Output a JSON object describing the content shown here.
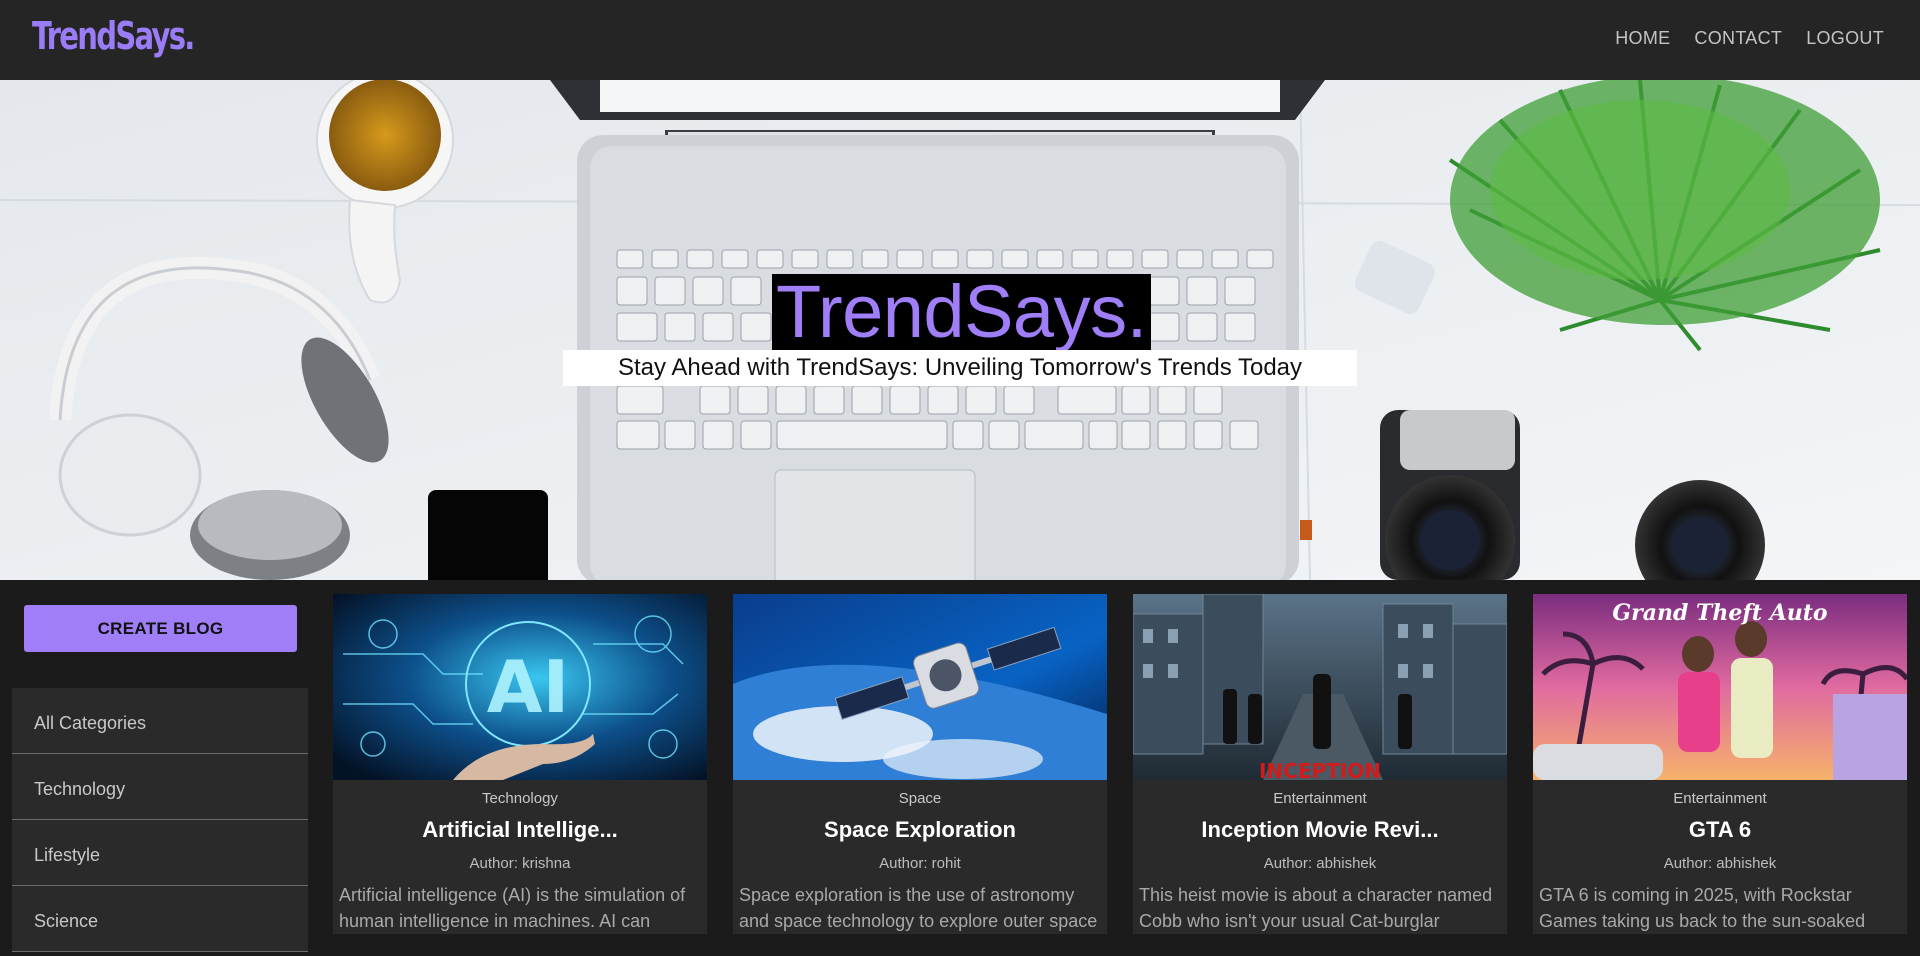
{
  "brand": {
    "logo": "TrendSays.",
    "accent": "#a07ef8"
  },
  "nav": {
    "items": [
      "HOME",
      "CONTACT",
      "LOGOUT"
    ]
  },
  "hero": {
    "title": "TrendSays.",
    "subtitle": "Stay Ahead with TrendSays: Unveiling Tomorrow's Trends Today"
  },
  "sidebar": {
    "create_label": "CREATE BLOG",
    "categories": [
      "All Categories",
      "Technology",
      "Lifestyle",
      "Science"
    ]
  },
  "posts": [
    {
      "category": "Technology",
      "title": "Artificial Intellige...",
      "author": "Author: krishna",
      "excerpt": "Artificial intelligence (AI) is the simulation of human intelligence in machines. AI can",
      "image": "ai-hand-hologram"
    },
    {
      "category": "Space",
      "title": "Space Exploration",
      "author": "Author: rohit",
      "excerpt": "Space exploration is the use of astronomy and space technology to explore outer space",
      "image": "satellite-over-earth"
    },
    {
      "category": "Entertainment",
      "title": "Inception Movie Revi...",
      "author": "Author: abhishek",
      "excerpt": "This heist movie is about a character named Cobb who isn't your usual Cat-burglar",
      "image": "inception-poster"
    },
    {
      "category": "Entertainment",
      "title": "GTA 6",
      "author": "Author: abhishek",
      "excerpt": "GTA 6 is coming in 2025, with Rockstar Games taking us back to the sun-soaked",
      "image": "gta6-artwork"
    }
  ]
}
